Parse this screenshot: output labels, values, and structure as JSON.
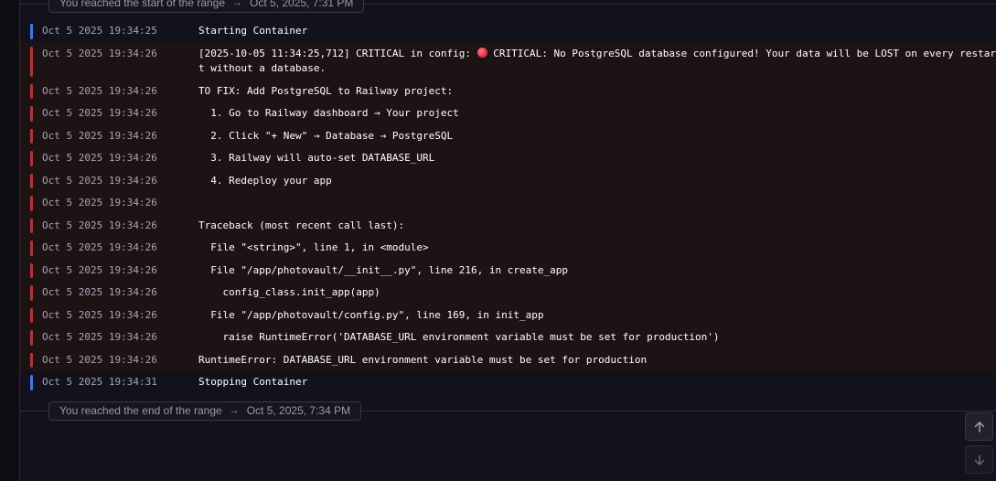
{
  "range_start": {
    "text": "You reached the start of the range",
    "arrow": "→",
    "time": "Oct 5, 2025, 7:31 PM"
  },
  "range_end": {
    "text": "You reached the end of the range",
    "arrow": "→",
    "time": "Oct 5, 2025, 7:34 PM"
  },
  "logs": [
    {
      "level": "info",
      "ts": "Oct 5 2025 19:34:25",
      "msg": "Starting Container"
    },
    {
      "level": "error",
      "ts": "Oct 5 2025 19:34:26",
      "msg_pre": "[2025-10-05 11:34:25,712] CRITICAL in config: ",
      "icon": "red-circle-icon",
      "msg_post": " CRITICAL: No PostgreSQL database configured! Your data will be LOST on every restart without a database."
    },
    {
      "level": "error",
      "ts": "Oct 5 2025 19:34:26",
      "msg": "TO FIX: Add PostgreSQL to Railway project:"
    },
    {
      "level": "error",
      "ts": "Oct 5 2025 19:34:26",
      "msg": "  1. Go to Railway dashboard → Your project"
    },
    {
      "level": "error",
      "ts": "Oct 5 2025 19:34:26",
      "msg": "  2. Click \"+ New\" → Database → PostgreSQL"
    },
    {
      "level": "error",
      "ts": "Oct 5 2025 19:34:26",
      "msg": "  3. Railway will auto-set DATABASE_URL"
    },
    {
      "level": "error",
      "ts": "Oct 5 2025 19:34:26",
      "msg": "  4. Redeploy your app"
    },
    {
      "level": "error",
      "ts": "Oct 5 2025 19:34:26",
      "msg": ""
    },
    {
      "level": "error",
      "ts": "Oct 5 2025 19:34:26",
      "msg": "Traceback (most recent call last):"
    },
    {
      "level": "error",
      "ts": "Oct 5 2025 19:34:26",
      "msg": "  File \"<string>\", line 1, in <module>"
    },
    {
      "level": "error",
      "ts": "Oct 5 2025 19:34:26",
      "msg": "  File \"/app/photovault/__init__.py\", line 216, in create_app"
    },
    {
      "level": "error",
      "ts": "Oct 5 2025 19:34:26",
      "msg": "    config_class.init_app(app)"
    },
    {
      "level": "error",
      "ts": "Oct 5 2025 19:34:26",
      "msg": "  File \"/app/photovault/config.py\", line 169, in init_app"
    },
    {
      "level": "error",
      "ts": "Oct 5 2025 19:34:26",
      "msg": "    raise RuntimeError('DATABASE_URL environment variable must be set for production')"
    },
    {
      "level": "error",
      "ts": "Oct 5 2025 19:34:26",
      "msg": "RuntimeError: DATABASE_URL environment variable must be set for production"
    },
    {
      "level": "info",
      "ts": "Oct 5 2025 19:34:31",
      "msg": "Stopping Container"
    }
  ],
  "scroll": {
    "up_icon": "arrow-up-icon",
    "down_icon": "arrow-down-icon"
  },
  "colors": {
    "info_bar": "#4c74e8",
    "error_bar": "#b23535",
    "error_row_bg": "#1d1315"
  }
}
